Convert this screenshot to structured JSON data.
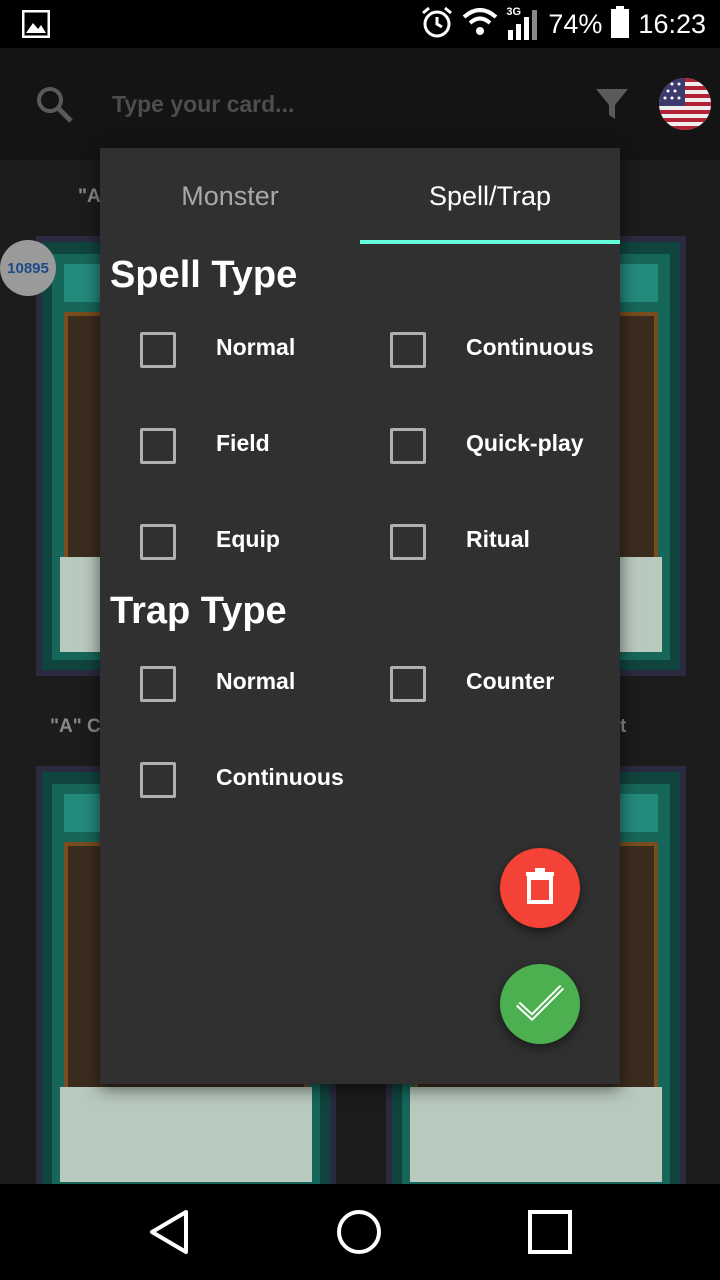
{
  "status_bar": {
    "network": "3G",
    "battery": "74%",
    "time": "16:23"
  },
  "toolbar": {
    "search_placeholder": "Type your card..."
  },
  "background": {
    "card_titles": [
      "\"A\"",
      "\"A\" Ce",
      "t"
    ],
    "card_count": "10895"
  },
  "dialog": {
    "tabs": [
      {
        "label": "Monster",
        "selected": false
      },
      {
        "label": "Spell/Trap",
        "selected": true
      }
    ],
    "spell_type": {
      "title": "Spell Type",
      "options": [
        "Normal",
        "Continuous",
        "Field",
        "Quick-play",
        "Equip",
        "Ritual"
      ]
    },
    "trap_type": {
      "title": "Trap Type",
      "options": [
        "Normal",
        "Counter",
        "Continuous"
      ]
    }
  },
  "colors": {
    "tab_indicator": "#64ffda",
    "delete_fab": "#f44336",
    "confirm_fab": "#4caf50",
    "dialog_bg": "#303030"
  },
  "icons": {
    "gallery": "gallery-icon",
    "alarm": "alarm-icon",
    "wifi": "wifi-icon",
    "signal": "signal-icon",
    "battery": "battery-icon",
    "search": "search-icon",
    "filter": "filter-icon",
    "flag": "us-flag-icon",
    "delete": "trash-icon",
    "confirm": "check-icon",
    "back": "back-icon",
    "home": "home-icon",
    "recents": "recents-icon"
  }
}
